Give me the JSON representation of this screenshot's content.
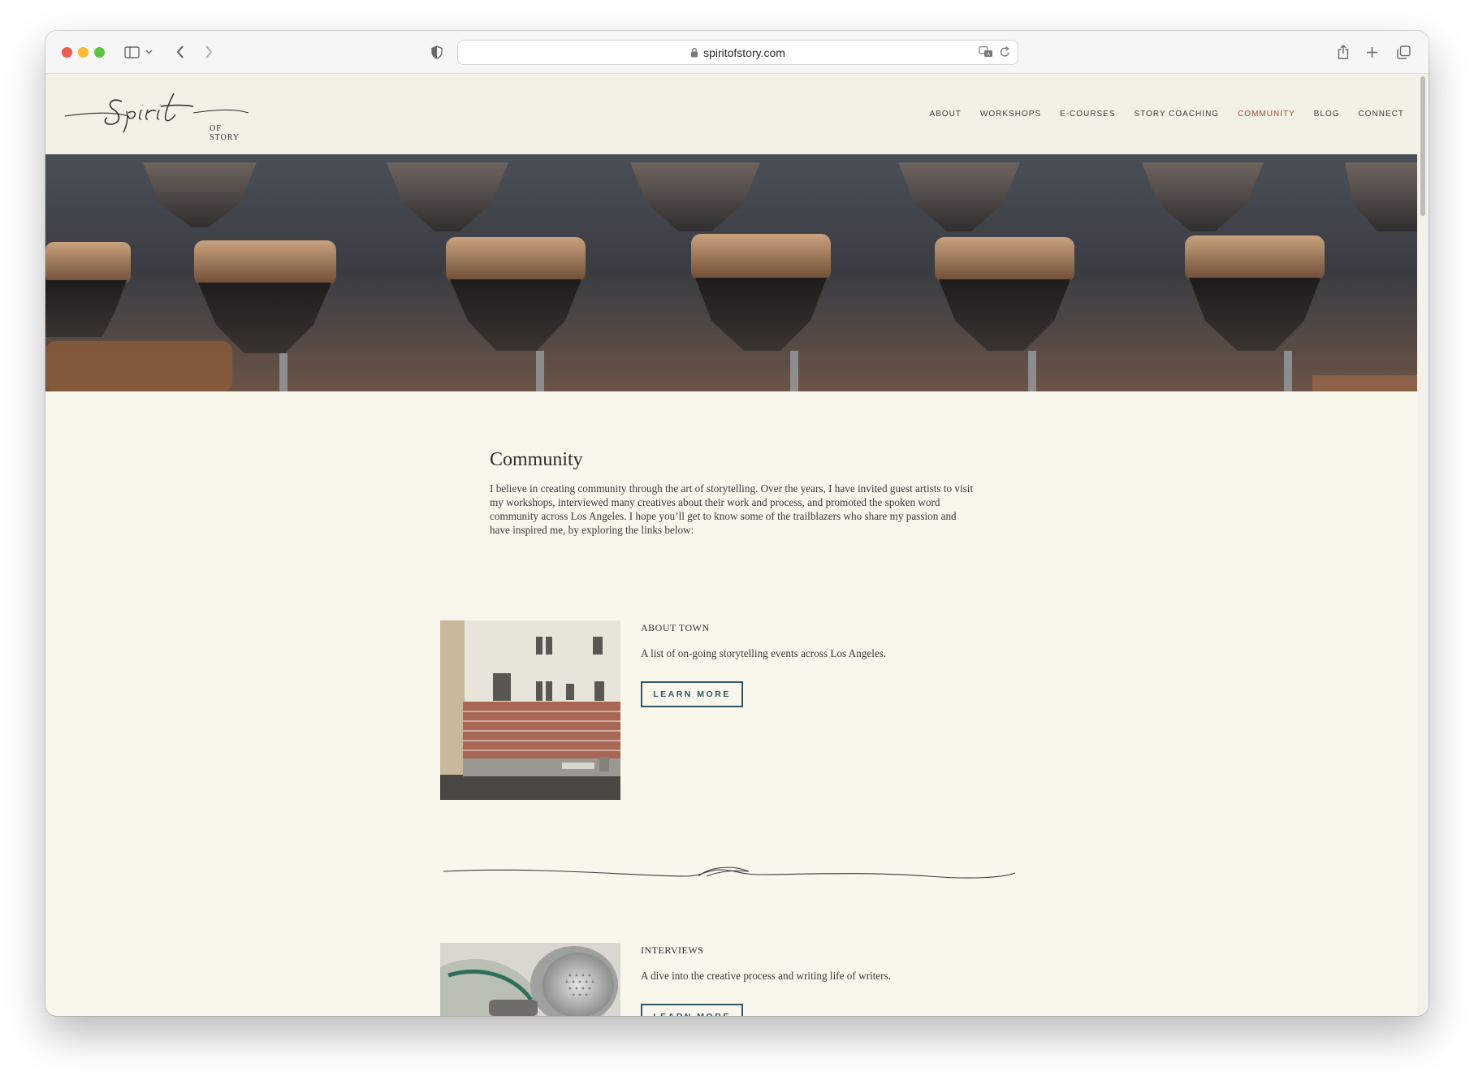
{
  "browser": {
    "url": "spiritofstory.com"
  },
  "site": {
    "logo_text": "OF STORY",
    "nav": [
      {
        "label": "ABOUT",
        "active": false
      },
      {
        "label": "WORKSHOPS",
        "active": false
      },
      {
        "label": "E-COURSES",
        "active": false
      },
      {
        "label": "STORY COACHING",
        "active": false
      },
      {
        "label": "COMMUNITY",
        "active": true
      },
      {
        "label": "BLOG",
        "active": false
      },
      {
        "label": "CONNECT",
        "active": false
      }
    ],
    "accent_color": "#a04a2f"
  },
  "main": {
    "title": "Community",
    "intro": "I believe in creating community through the art of storytelling. Over the years, I have invited guest artists to visit my workshops, interviewed many creatives about their work and process, and promoted the spoken word community across Los Angeles. I hope you’ll get to know some of the trailblazers who share my passion and have inspired me, by exploring the links below:",
    "items": [
      {
        "label": "ABOUT TOWN",
        "description": "A list of on-going storytelling events across Los Angeles.",
        "button": "LEARN MORE"
      },
      {
        "label": "INTERVIEWS",
        "description": "A dive into the creative process and writing life of writers.",
        "button": "LEARN MORE"
      }
    ]
  }
}
